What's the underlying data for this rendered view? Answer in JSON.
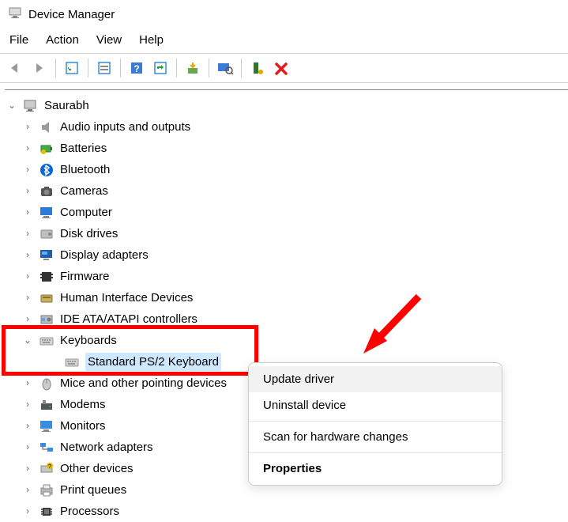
{
  "window": {
    "title": "Device Manager"
  },
  "menubar": [
    "File",
    "Action",
    "View",
    "Help"
  ],
  "toolbar_icons": [
    "back",
    "forward",
    "show-hidden",
    "properties",
    "help",
    "update",
    "uninstall",
    "scan",
    "device",
    "delete"
  ],
  "root_name": "Saurabh",
  "tree": [
    {
      "label": "Audio inputs and outputs",
      "icon": "speaker"
    },
    {
      "label": "Batteries",
      "icon": "battery"
    },
    {
      "label": "Bluetooth",
      "icon": "bluetooth"
    },
    {
      "label": "Cameras",
      "icon": "camera"
    },
    {
      "label": "Computer",
      "icon": "monitor-blue"
    },
    {
      "label": "Disk drives",
      "icon": "disk"
    },
    {
      "label": "Display adapters",
      "icon": "display"
    },
    {
      "label": "Firmware",
      "icon": "chip-dark"
    },
    {
      "label": "Human Interface Devices",
      "icon": "hid"
    },
    {
      "label": "IDE ATA/ATAPI controllers",
      "icon": "ide"
    },
    {
      "label": "Keyboards",
      "icon": "keyboard",
      "expanded": true,
      "children": [
        {
          "label": "Standard PS/2 Keyboard",
          "icon": "keyboard",
          "selected": true
        }
      ]
    },
    {
      "label": "Mice and other pointing devices",
      "icon": "mouse"
    },
    {
      "label": "Modems",
      "icon": "modem"
    },
    {
      "label": "Monitors",
      "icon": "monitor"
    },
    {
      "label": "Network adapters",
      "icon": "network"
    },
    {
      "label": "Other devices",
      "icon": "other"
    },
    {
      "label": "Print queues",
      "icon": "printer"
    },
    {
      "label": "Processors",
      "icon": "cpu"
    }
  ],
  "context_menu": {
    "update": "Update driver",
    "uninstall": "Uninstall device",
    "scan": "Scan for hardware changes",
    "properties": "Properties"
  }
}
